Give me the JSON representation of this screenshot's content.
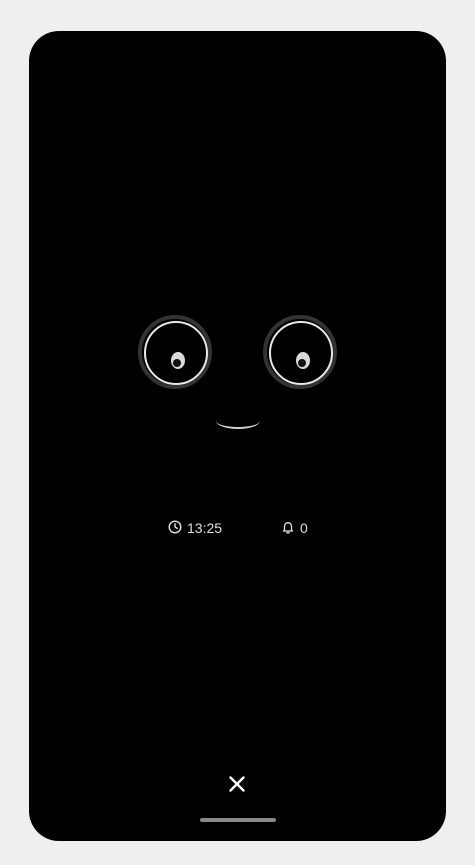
{
  "status": {
    "time": "13:25",
    "time_icon": "clock-icon",
    "notifications_count": "0",
    "notifications_icon": "bell-icon"
  },
  "controls": {
    "close_icon": "close-icon"
  },
  "colors": {
    "screen_background": "#000000",
    "page_background": "#efefef",
    "eye_ring": "#333333",
    "eye_outline": "#e8e8e8",
    "text": "#e0e0e0"
  }
}
